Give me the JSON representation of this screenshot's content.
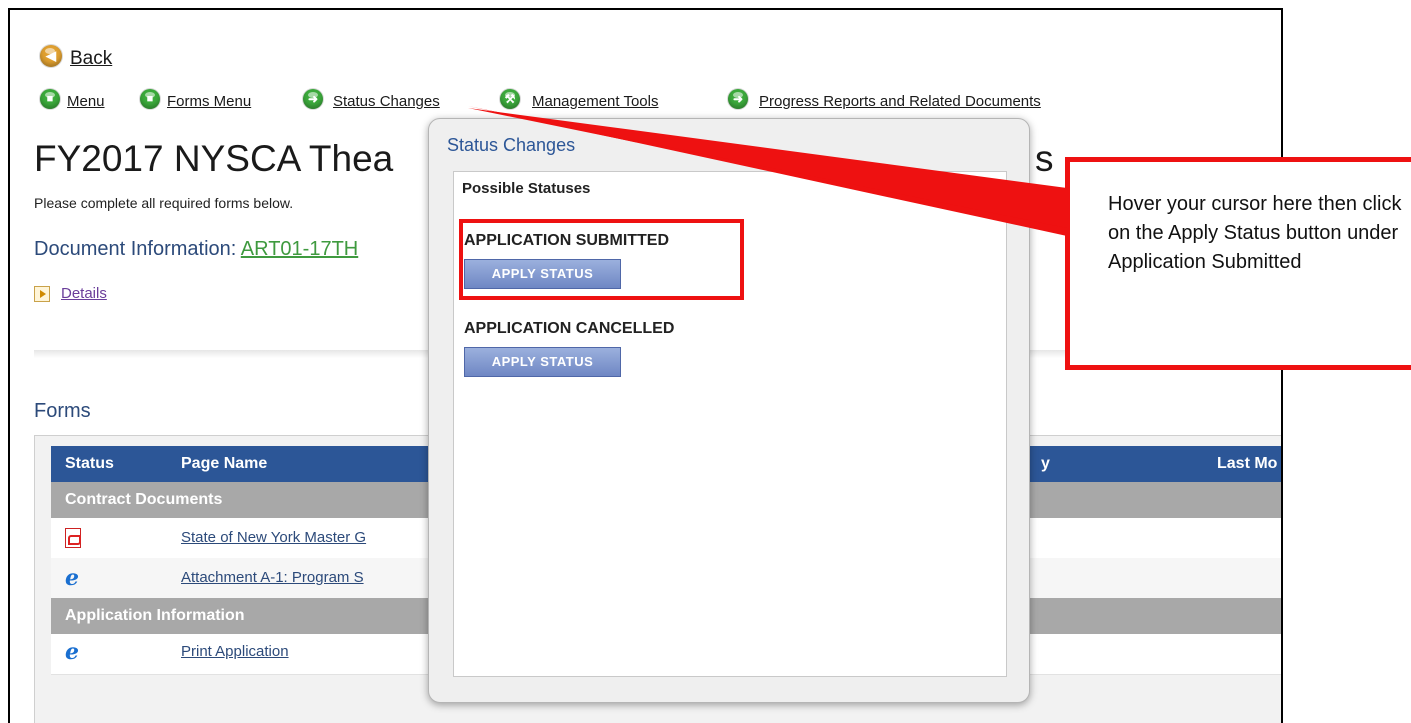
{
  "nav": {
    "back_label": "Back",
    "menu_label": "Menu",
    "forms_menu_label": "Forms Menu",
    "status_changes_label": "Status Changes",
    "management_tools_label": "Management Tools",
    "progress_reports_label": "Progress Reports and Related Documents"
  },
  "page": {
    "title": "FY2017 NYSCA Thea",
    "title_tail": "s",
    "instructions": "Please complete all required forms below.",
    "doc_info_label": "Document Information: ",
    "doc_info_value": "ART01-17TH",
    "details_label": "Details",
    "forms_label": "Forms"
  },
  "table": {
    "columns": {
      "status": "Status",
      "page_name": "Page Name",
      "by": "y",
      "last_modified": "Last Mo"
    },
    "groups": [
      {
        "label": "Contract Documents",
        "rows": [
          {
            "icon": "pdf-icon",
            "name": "State of New York Master G"
          },
          {
            "icon": "ie-icon",
            "name": "Attachment A-1: Program S"
          }
        ]
      },
      {
        "label": "Application Information",
        "rows": [
          {
            "icon": "ie-icon",
            "name": "Print Application"
          }
        ]
      }
    ]
  },
  "popup": {
    "title": "Status Changes",
    "heading": "Possible Statuses",
    "statuses": [
      {
        "name": "APPLICATION SUBMITTED",
        "button": "APPLY STATUS"
      },
      {
        "name": "APPLICATION CANCELLED",
        "button": "APPLY STATUS"
      }
    ]
  },
  "callout": {
    "text": "Hover your cursor here then click on the Apply Status button under Application Submitted"
  },
  "colors": {
    "annotation_red": "#ee1111",
    "header_blue": "#2c5697",
    "group_gray": "#a8a8a8",
    "doc_link_green": "#3f9a3f"
  }
}
